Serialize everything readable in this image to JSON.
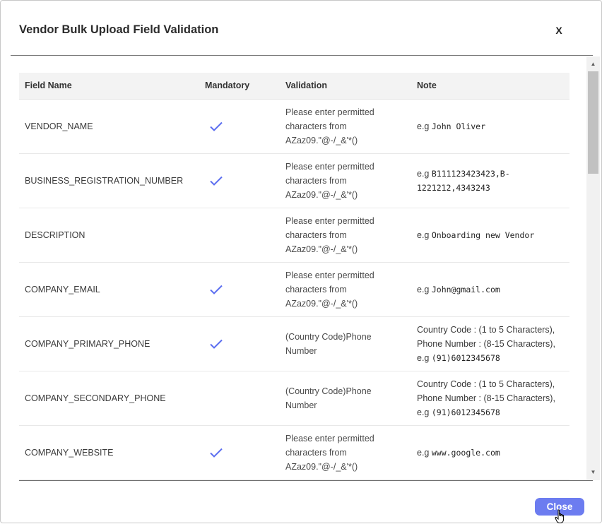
{
  "dialog": {
    "title": "Vendor Bulk Upload Field Validation",
    "close_x": "X",
    "close_button": "Close"
  },
  "table": {
    "headers": {
      "field_name": "Field Name",
      "mandatory": "Mandatory",
      "validation": "Validation",
      "note": "Note"
    },
    "rows": [
      {
        "field": "VENDOR_NAME",
        "mandatory": true,
        "validation": [
          "Please enter permitted",
          "characters from",
          "AZaz09.\"@-/_&'*()"
        ],
        "note_prefix": "e.g ",
        "note_lines": [],
        "note_code": [
          "John Oliver"
        ]
      },
      {
        "field": "BUSINESS_REGISTRATION_NUMBER",
        "mandatory": true,
        "validation": [
          "Please enter permitted",
          "characters from",
          "AZaz09.\"@-/_&'*()"
        ],
        "note_prefix": "e.g ",
        "note_lines": [],
        "note_code": [
          "B111123423423,B-",
          "1221212,4343243"
        ]
      },
      {
        "field": "DESCRIPTION",
        "mandatory": false,
        "validation": [
          "Please enter permitted",
          "characters from",
          "AZaz09.\"@-/_&'*()"
        ],
        "note_prefix": "e.g ",
        "note_lines": [],
        "note_code": [
          "Onboarding new Vendor"
        ]
      },
      {
        "field": "COMPANY_EMAIL",
        "mandatory": true,
        "validation": [
          "Please enter permitted",
          "characters from",
          "AZaz09.\"@-/_&'*()"
        ],
        "note_prefix": "e.g ",
        "note_lines": [],
        "note_code": [
          "John@gmail.com"
        ]
      },
      {
        "field": "COMPANY_PRIMARY_PHONE",
        "mandatory": true,
        "validation": [
          "(Country Code)Phone",
          "Number"
        ],
        "note_prefix": "e.g ",
        "note_lines": [
          "Country Code : (1 to 5 Characters),",
          "Phone Number : (8-15 Characters),"
        ],
        "note_code": [
          "(91)6012345678"
        ]
      },
      {
        "field": "COMPANY_SECONDARY_PHONE",
        "mandatory": false,
        "validation": [
          "(Country Code)Phone",
          "Number"
        ],
        "note_prefix": "e.g ",
        "note_lines": [
          "Country Code : (1 to 5 Characters),",
          "Phone Number : (8-15 Characters),"
        ],
        "note_code": [
          "(91)6012345678"
        ]
      },
      {
        "field": "COMPANY_WEBSITE",
        "mandatory": true,
        "validation": [
          "Please enter permitted",
          "characters from",
          "AZaz09.\"@-/_&'*()"
        ],
        "note_prefix": "e.g ",
        "note_lines": [],
        "note_code": [
          "www.google.com"
        ]
      }
    ]
  },
  "scrollbar": {
    "up_arrow": "▲",
    "down_arrow": "▼"
  },
  "colors": {
    "check": "#5b6ef0",
    "close_button": "#6c7cf0"
  }
}
